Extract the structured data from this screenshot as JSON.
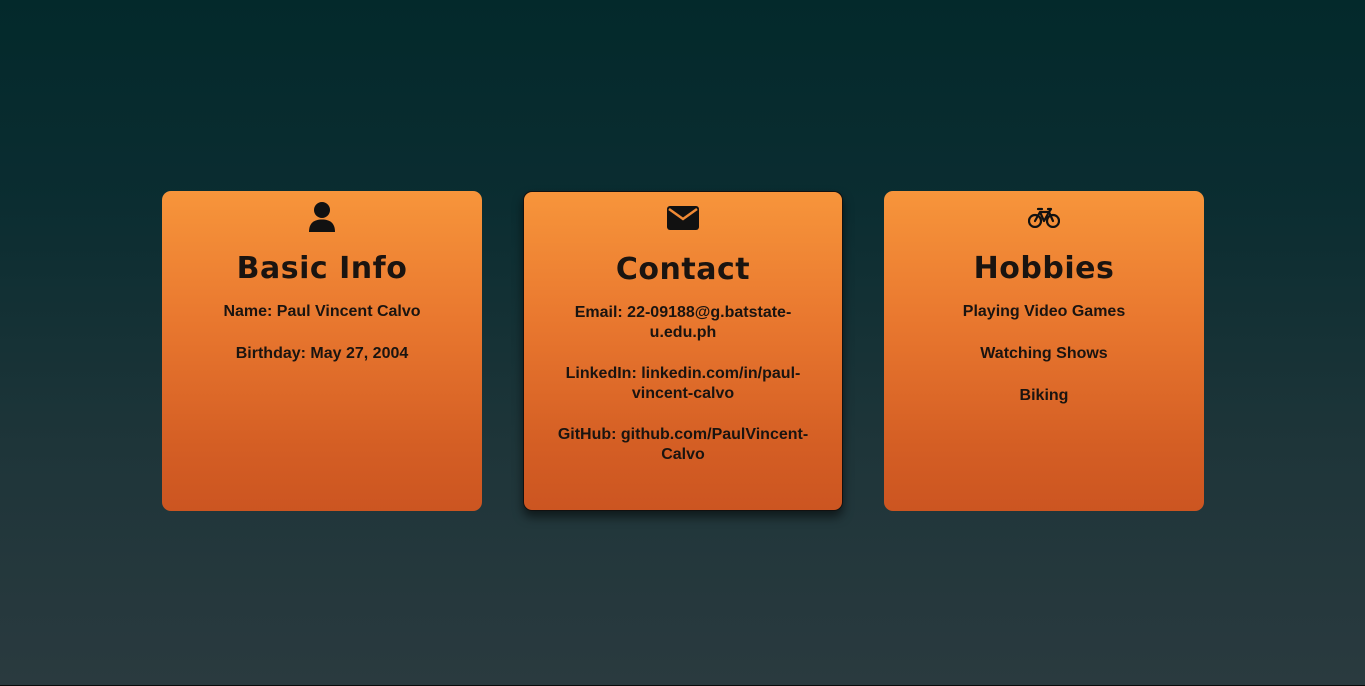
{
  "cards": [
    {
      "icon": "user-icon",
      "title": "Basic Info",
      "lines": [
        "Name: Paul Vincent Calvo",
        "Birthday: May 27, 2004"
      ]
    },
    {
      "icon": "envelope-icon",
      "title": "Contact",
      "lines": [
        "Email: 22-09188@g.batstate-u.edu.ph",
        "LinkedIn: linkedin.com/in/paul-vincent-calvo",
        "GitHub: github.com/PaulVincent-Calvo"
      ]
    },
    {
      "icon": "bicycle-icon",
      "title": "Hobbies",
      "lines": [
        "Playing Video Games",
        "Watching Shows",
        "Biking"
      ]
    }
  ],
  "colors": {
    "card_gradient_top": "#f7953b",
    "card_gradient_bottom": "#cc5521",
    "background_top": "#03292b",
    "background_bottom": "#2a3a3f",
    "text": "#1a1410"
  }
}
